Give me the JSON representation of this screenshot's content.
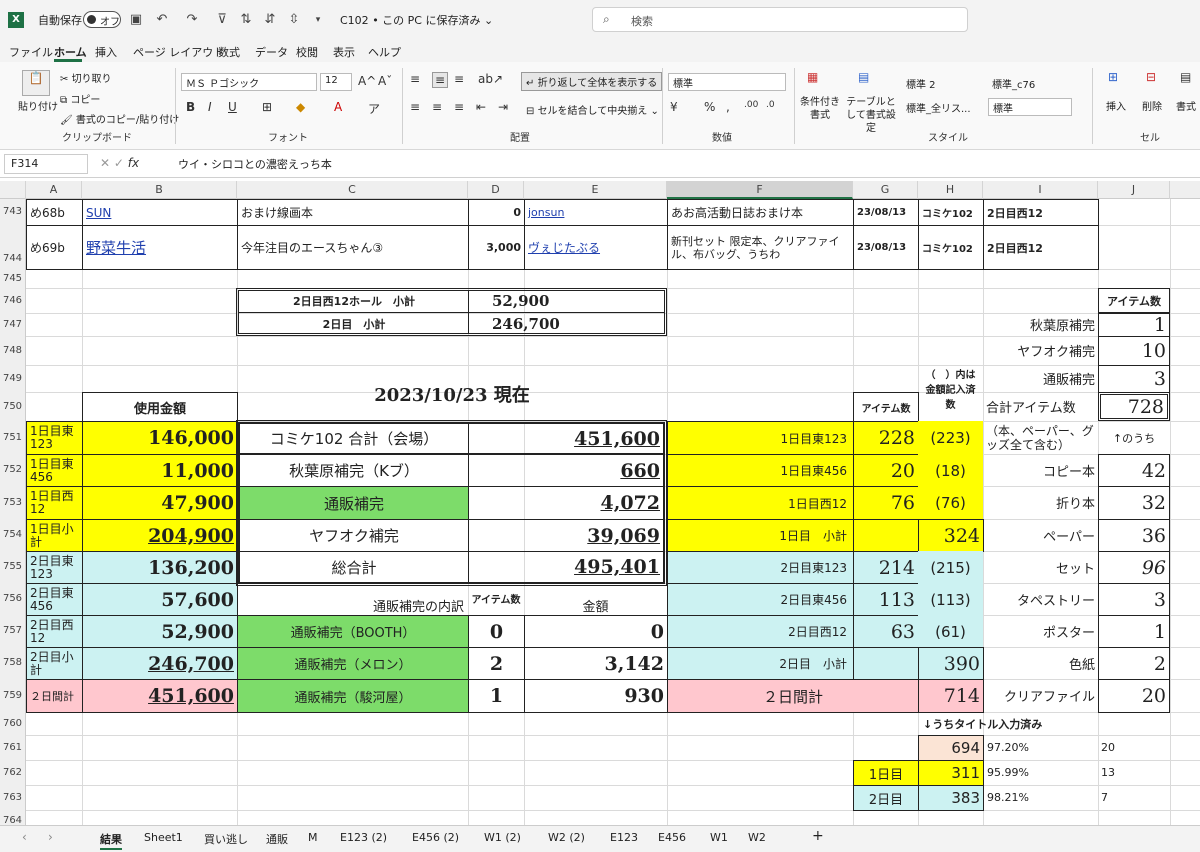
{
  "titlebar": {
    "autosave_label": "自動保存",
    "toggle_state": "オフ",
    "filename": "C102",
    "save_state": "• この PC に保存済み",
    "search_placeholder": "検索"
  },
  "menu": {
    "tabs": [
      "ファイル",
      "ホーム",
      "挿入",
      "ページ レイアウト",
      "数式",
      "データ",
      "校閲",
      "表示",
      "ヘルプ"
    ],
    "active": "ホーム"
  },
  "ribbon": {
    "paste": "貼り付け",
    "cut": "切り取り",
    "copy": "コピー",
    "format_painter": "書式のコピー/貼り付け",
    "clipboard": "クリップボード",
    "font_name": "ＭＳ Ｐゴシック",
    "font_size": "12",
    "font_group": "フォント",
    "wrap_text": "折り返して全体を表示する",
    "merge_center": "セルを結合して中央揃え",
    "alignment": "配置",
    "number_format": "標準",
    "number": "数値",
    "cond_format": "条件付き書式",
    "table_format": "テーブルとして書式設定",
    "style1": "標準 2",
    "style2": "標準_c76",
    "style3": "標準_全リス...",
    "style4": "標準",
    "styles": "スタイル",
    "insert": "挿入",
    "delete": "削除",
    "format": "書式",
    "cells": "セル"
  },
  "formula_bar": {
    "name_box": "F314",
    "content": "ウイ・シロコとの濃密えっち本"
  },
  "columns": [
    "A",
    "B",
    "C",
    "D",
    "E",
    "F",
    "G",
    "H",
    "I",
    "J"
  ],
  "selected_column": "F",
  "rows": [
    "743",
    "744",
    "745",
    "746",
    "747",
    "748",
    "749",
    "750",
    "751",
    "752",
    "753",
    "754",
    "755",
    "756",
    "757",
    "758",
    "759",
    "760",
    "761",
    "762",
    "763",
    "764"
  ],
  "circles": [
    {
      "booth": "め68b",
      "name": "SUN",
      "title": "おまけ線画本",
      "price": "0",
      "twitter": "jonsun",
      "note": "あお高活動日誌おまけ本",
      "date": "23/08/13",
      "event": "コミケ102",
      "day": "2日目西12"
    },
    {
      "booth": "め69b",
      "name": "野菜牛活",
      "title": "今年注目のエースちゃん③",
      "price": "3,000",
      "twitter": "ヴぇじたぶる",
      "note": "新刊セット 限定本、クリアファイル、布バッグ、うちわ",
      "date": "23/08/13",
      "event": "コミケ102",
      "day": "2日目西12"
    }
  ],
  "subtotals": [
    {
      "label": "2日目西12ホール　小計",
      "value": "52,900"
    },
    {
      "label": "2日目　小計",
      "value": "246,700"
    }
  ],
  "date_title": "2023/10/23 現在",
  "usage_header": "使用金額",
  "usage": [
    {
      "label": "1日目東123",
      "value": "146,000"
    },
    {
      "label": "1日目東456",
      "value": "11,000"
    },
    {
      "label": "1日目西12",
      "value": "47,900"
    },
    {
      "label": "1日目小計",
      "value": "204,900"
    },
    {
      "label": "2日目東123",
      "value": "136,200"
    },
    {
      "label": "2日目東456",
      "value": "57,600"
    },
    {
      "label": "2日目西12",
      "value": "52,900"
    },
    {
      "label": "2日目小計",
      "value": "246,700"
    },
    {
      "label": "２日間計",
      "value": "451,600"
    }
  ],
  "totals": [
    {
      "label": "コミケ102 合計（会場）",
      "value": "451,600"
    },
    {
      "label": "秋葉原補完（Kブ）",
      "value": "660"
    },
    {
      "label": "通販補完",
      "value": "4,072"
    },
    {
      "label": "ヤフオク補完",
      "value": "39,069"
    },
    {
      "label": "総合計",
      "value": "495,401"
    }
  ],
  "mail_header": {
    "label": "通販補完の内訳",
    "items": "アイテム数",
    "amount": "金額"
  },
  "mail": [
    {
      "label": "通販補完（BOOTH）",
      "items": "0",
      "amount": "0"
    },
    {
      "label": "通販補完（メロン）",
      "items": "2",
      "amount": "3,142"
    },
    {
      "label": "通販補完（駿河屋）",
      "items": "1",
      "amount": "930"
    }
  ],
  "item_header": {
    "items": "アイテム数",
    "note": "（　）内は金額記入済数"
  },
  "items": [
    {
      "label": "1日目東123",
      "count": "228",
      "filled": "(223)"
    },
    {
      "label": "1日目東456",
      "count": "20",
      "filled": "(18)"
    },
    {
      "label": "1日目西12",
      "count": "76",
      "filled": "(76)"
    },
    {
      "label": "1日目　小計",
      "count": "",
      "filled": "324"
    },
    {
      "label": "2日目東123",
      "count": "214",
      "filled": "(215)"
    },
    {
      "label": "2日目東456",
      "count": "113",
      "filled": "(113)"
    },
    {
      "label": "2日目西12",
      "count": "63",
      "filled": "(61)"
    },
    {
      "label": "2日目　小計",
      "count": "",
      "filled": "390"
    },
    {
      "label": "２日間計",
      "count": "",
      "filled": "714"
    }
  ],
  "right_header": "アイテム数",
  "right": [
    {
      "label": "秋葉原補完",
      "value": "1"
    },
    {
      "label": "ヤフオク補完",
      "value": "10"
    },
    {
      "label": "通販補完",
      "value": "3"
    },
    {
      "label": "合計アイテム数",
      "value": "728"
    },
    {
      "label": "（本、ペーパー、グッズ全て含む）",
      "value": "↑のうち"
    },
    {
      "label": "コピー本",
      "value": "42"
    },
    {
      "label": "折り本",
      "value": "32"
    },
    {
      "label": "ペーパー",
      "value": "36"
    },
    {
      "label": "セット",
      "value": "96"
    },
    {
      "label": "タペストリー",
      "value": "3"
    },
    {
      "label": "ポスター",
      "value": "1"
    },
    {
      "label": "色紙",
      "value": "2"
    },
    {
      "label": "クリアファイル",
      "value": "20"
    }
  ],
  "title_note": "↓うちタイトル入力済み",
  "title_stats": [
    {
      "label": "",
      "value": "694",
      "pct": "97.20%",
      "j": "20"
    },
    {
      "label": "1日目",
      "value": "311",
      "pct": "95.99%",
      "j": "13"
    },
    {
      "label": "2日目",
      "value": "383",
      "pct": "98.21%",
      "j": "7"
    }
  ],
  "sheet_tabs": [
    "結果",
    "Sheet1",
    "買い逃し",
    "通販",
    "M",
    "E123 (2)",
    "E456 (2)",
    "W1 (2)",
    "W2 (2)",
    "E123",
    "E456",
    "W1",
    "W2"
  ],
  "add_sheet": "+",
  "colors": {
    "accent": "#217346",
    "yellow": "#ffff00",
    "cyan": "#ccf2f2",
    "green": "#7ddc6a",
    "pink": "#ffc7ce"
  }
}
